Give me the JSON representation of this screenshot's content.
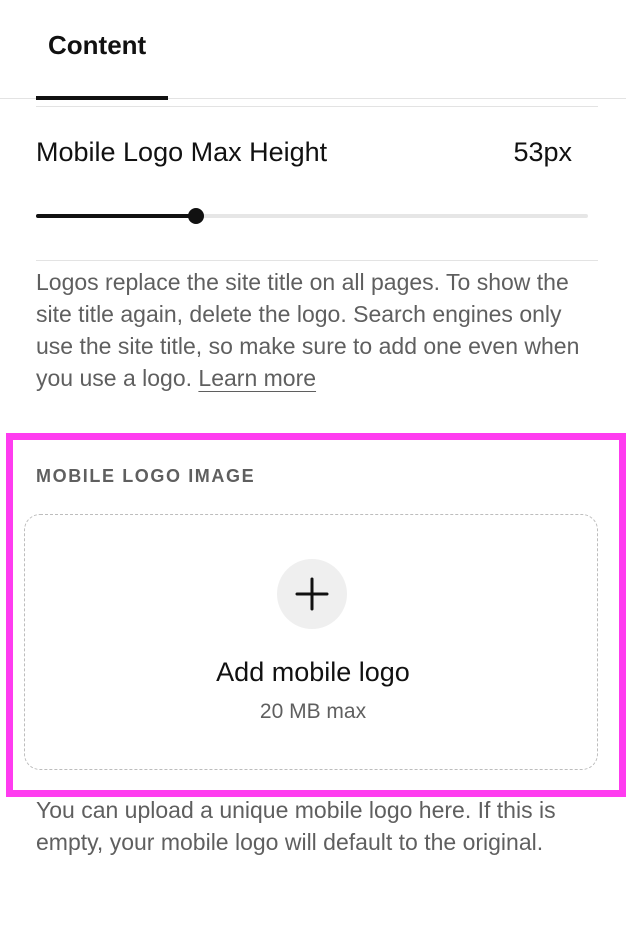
{
  "tabs": {
    "active_label": "Content"
  },
  "slider": {
    "title": "Mobile Logo Max Height",
    "value_label": "53px",
    "fill_fraction": 0.29
  },
  "info": {
    "text": "Logos replace the site title on all pages. To show the site title again, delete the logo. Search engines only use the site title, so make sure to add one even when you use a logo. ",
    "link_label": "Learn more"
  },
  "upload": {
    "section_label": "MOBILE LOGO IMAGE",
    "add_label": "Add mobile logo",
    "size_limit": "20 MB max",
    "icon": "plus-icon",
    "highlight_color": "#ff3cf0"
  },
  "help": {
    "text": "You can upload a unique mobile logo here. If this is empty, your mobile logo will default to the original."
  }
}
